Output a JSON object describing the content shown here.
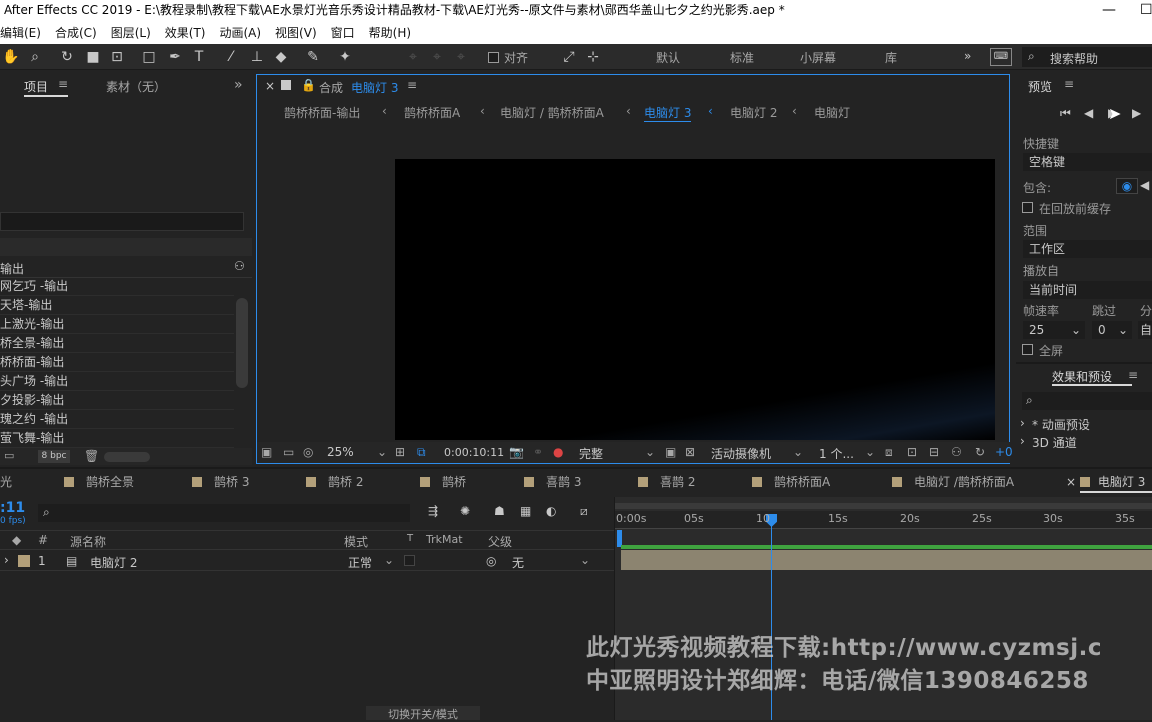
{
  "window": {
    "title": "After Effects CC 2019 - E:\\教程录制\\教程下载\\AE水景灯光音乐秀设计精品教材-下载\\AE灯光秀--原文件与素材\\郧西华盖山七夕之约光影秀.aep *"
  },
  "menu": [
    "编辑(E)",
    "合成(C)",
    "图层(L)",
    "效果(T)",
    "动画(A)",
    "视图(V)",
    "窗口",
    "帮助(H)"
  ],
  "toolbar": {
    "align_label": "对齐",
    "workspaces": [
      "默认",
      "标准",
      "小屏幕",
      "库"
    ],
    "search_placeholder": "搜索帮助"
  },
  "project": {
    "tab_project": "项目",
    "tab_footage": "素材（无）",
    "column_name": "输出",
    "items": [
      "网乞巧 -输出",
      "天塔-输出",
      "上激光-输出",
      "桥全景-输出",
      "桥桥面-输出",
      "头广场 -输出",
      "夕投影-输出",
      "瑰之约 -输出",
      "萤飞舞-输出"
    ],
    "bpc": "8 bpc"
  },
  "composition": {
    "tab_prefix": "合成",
    "tab_name": "电脑灯 3",
    "breadcrumbs": [
      "鹊桥桥面-输出",
      "鹊桥桥面A",
      "电脑灯 / 鹊桥桥面A",
      "电脑灯 3",
      "电脑灯 2",
      "电脑灯"
    ],
    "active_breadcrumb": "电脑灯 3",
    "zoom": "25%",
    "timecode": "0:00:10:11",
    "resolution": "完整",
    "camera": "活动摄像机",
    "views": "1 个...",
    "exposure": "+0"
  },
  "preview": {
    "title": "预览",
    "shortcut_label": "快捷键",
    "shortcut_value": "空格键",
    "include_label": "包含:",
    "cache_label": "在回放前缓存",
    "range_label": "范围",
    "range_value": "工作区",
    "play_from_label": "播放自",
    "play_from_value": "当前时间",
    "framerate_label": "帧速率",
    "skip_label": "跳过",
    "res_label": "分",
    "framerate_value": "25",
    "skip_value": "0",
    "res_value": "自",
    "fullscreen_label": "全屏"
  },
  "effects": {
    "title": "效果和预设",
    "items": [
      "* 动画预设",
      "3D 通道"
    ]
  },
  "timeline": {
    "tabs": [
      "光",
      "鹊桥全景",
      "鹊桥 3",
      "鹊桥 2",
      "鹊桥",
      "喜鹊 3",
      "喜鹊 2",
      "鹊桥桥面A",
      "电脑灯 /鹊桥桥面A",
      "电脑灯 3"
    ],
    "active_tab": "电脑灯 3",
    "timecode": ":11",
    "fps": "0 fps)",
    "columns": {
      "num": "#",
      "source": "源名称",
      "mode": "模式",
      "t": "T",
      "trkmat": "TrkMat",
      "parent": "父级"
    },
    "layer": {
      "index": "1",
      "name": "电脑灯 2",
      "mode": "正常",
      "parent": "无"
    },
    "ruler": [
      "0:00s",
      "05s",
      "10",
      "15s",
      "20s",
      "25s",
      "30s",
      "35s"
    ],
    "footer": "切换开关/模式"
  },
  "watermark": {
    "line1": "此灯光秀视频教程下载:http://www.cyzmsj.c",
    "line2": "中亚照明设计郑细辉：电话/微信1390846258"
  },
  "colors": {
    "accent": "#2d8ceb",
    "label": "#b3a07a"
  }
}
